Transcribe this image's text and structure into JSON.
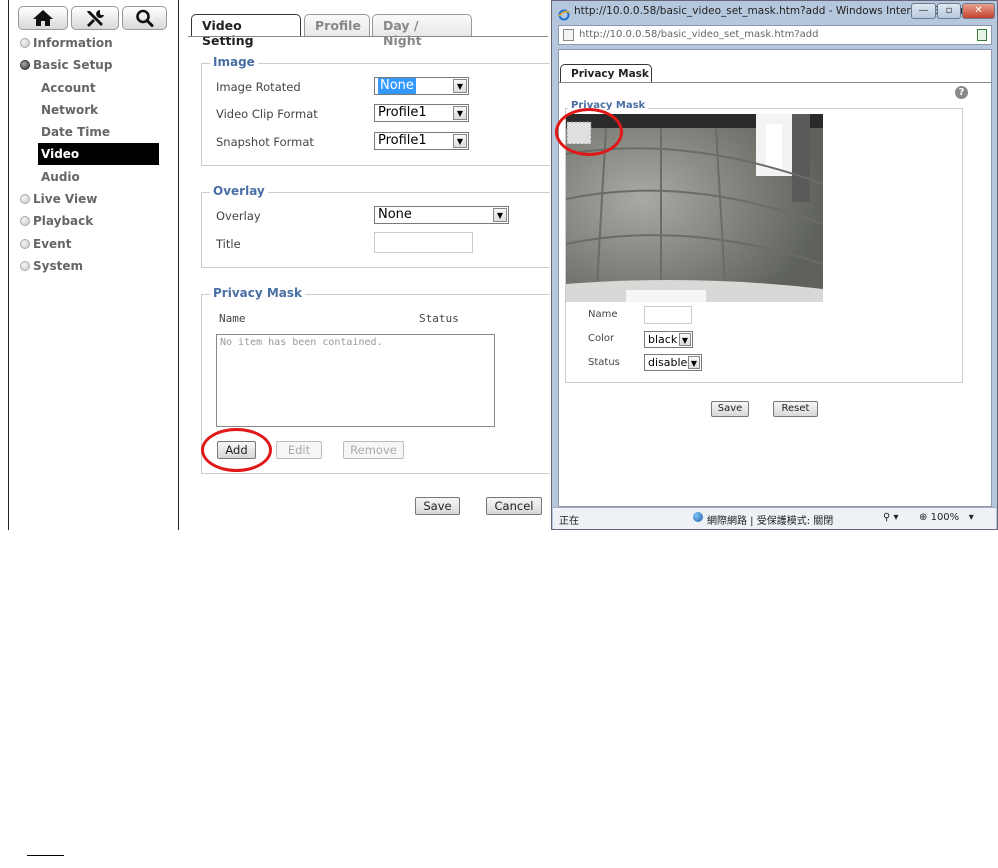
{
  "sidebar": {
    "top_icons": [
      "home-icon",
      "tools-icon",
      "search-icon"
    ],
    "nav": [
      {
        "label": "Information"
      },
      {
        "label": "Basic Setup"
      },
      {
        "label": "Live View"
      },
      {
        "label": "Playback"
      },
      {
        "label": "Event"
      },
      {
        "label": "System"
      }
    ],
    "sub_items": [
      {
        "label": "Account"
      },
      {
        "label": "Network"
      },
      {
        "label": "Date Time"
      },
      {
        "label": "Video"
      },
      {
        "label": "Audio"
      }
    ]
  },
  "tabs": [
    {
      "label": "Video Setting"
    },
    {
      "label": "Profile"
    },
    {
      "label": "Day / Night"
    }
  ],
  "image_section": {
    "legend": "Image",
    "rotated_label": "Image Rotated",
    "rotated_value": "None",
    "clip_label": "Video Clip Format",
    "clip_value": "Profile1",
    "snapshot_label": "Snapshot Format",
    "snapshot_value": "Profile1"
  },
  "overlay_section": {
    "legend": "Overlay",
    "overlay_label": "Overlay",
    "overlay_value": "None",
    "title_label": "Title",
    "title_value": ""
  },
  "privacy_section": {
    "legend": "Privacy Mask",
    "col_name": "Name",
    "col_status": "Status",
    "empty_text": "No item has been contained.",
    "add_label": "Add",
    "edit_label": "Edit",
    "remove_label": "Remove"
  },
  "footer": {
    "save_label": "Save",
    "cancel_label": "Cancel"
  },
  "popup": {
    "title": "http://10.0.0.58/basic_video_set_mask.htm?add - Windows Internet Explor...",
    "url": "http://10.0.0.58/basic_video_set_mask.htm?add",
    "tab_label": "Privacy Mask",
    "legend": "Privacy Mask",
    "name_label": "Name",
    "name_value": "",
    "color_label": "Color",
    "color_value": "black",
    "status_label": "Status",
    "status_value": "disable",
    "save_label": "Save",
    "reset_label": "Reset",
    "status_left": "正在",
    "status_zone": "網際網路 | 受保護模式: 關閉",
    "zoom": "100%"
  }
}
